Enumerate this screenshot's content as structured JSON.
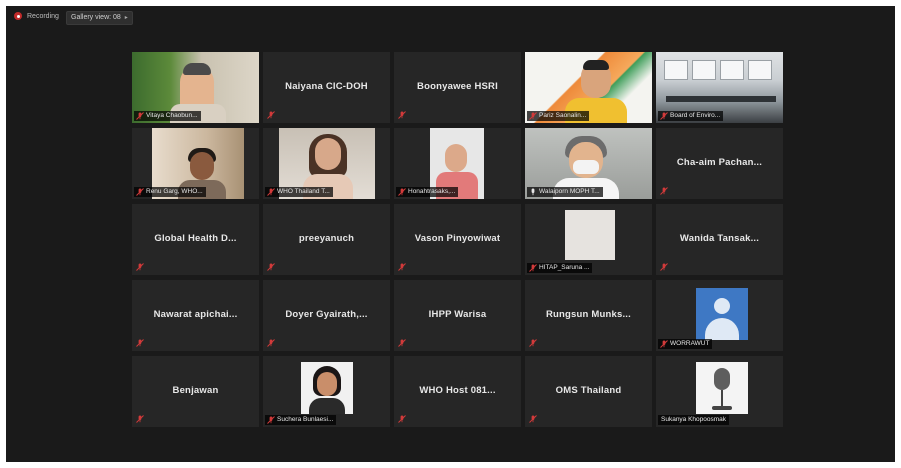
{
  "toolbar": {
    "recording_label": "Recording",
    "view_label": "Gallery view: 08"
  },
  "participants": [
    {
      "name": "Vitaya Chaobun...",
      "tile": "video"
    },
    {
      "name": "Naiyana CIC-DOH",
      "tile": "name"
    },
    {
      "name": "Boonyawee HSRI",
      "tile": "name"
    },
    {
      "name": "Pariz Saonalin...",
      "tile": "video"
    },
    {
      "name": "Board of Enviro...",
      "tile": "video"
    },
    {
      "name": "Renu Garg, WHO...",
      "tile": "video"
    },
    {
      "name": "WHO Thailand T...",
      "tile": "video"
    },
    {
      "name": "Honahtrasaks,...",
      "tile": "video"
    },
    {
      "name": "Walaiporn MOPH T...",
      "tile": "video",
      "active": true
    },
    {
      "name": "Cha-aim Pachan...",
      "tile": "name"
    },
    {
      "name": "Global Health D...",
      "tile": "name"
    },
    {
      "name": "preeyanuch",
      "tile": "name"
    },
    {
      "name": "Vason Pinyowiwat",
      "tile": "name"
    },
    {
      "name": "HITAP_Saruna ...",
      "tile": "video"
    },
    {
      "name": "Wanida Tansak...",
      "tile": "name"
    },
    {
      "name": "Nawarat apichai...",
      "tile": "name"
    },
    {
      "name": "Doyer Gyairath,...",
      "tile": "name"
    },
    {
      "name": "IHPP Warisa",
      "tile": "name"
    },
    {
      "name": "Rungsun Munks...",
      "tile": "name"
    },
    {
      "name": "WORRAWUT",
      "tile": "video"
    },
    {
      "name": "Benjawan",
      "tile": "name"
    },
    {
      "name": "Suchera Bunlaesi...",
      "tile": "video"
    },
    {
      "name": "WHO Host 081...",
      "tile": "name"
    },
    {
      "name": "OMS Thailand",
      "tile": "name"
    },
    {
      "name": "Sukanya Khopoosmak",
      "tile": "video"
    }
  ],
  "colors": {
    "background": "#1a1a1a",
    "tile": "#262626",
    "active_border": "#d9dc6a",
    "muted_mic": "#d23a3a",
    "recording": "#c22a2a"
  }
}
